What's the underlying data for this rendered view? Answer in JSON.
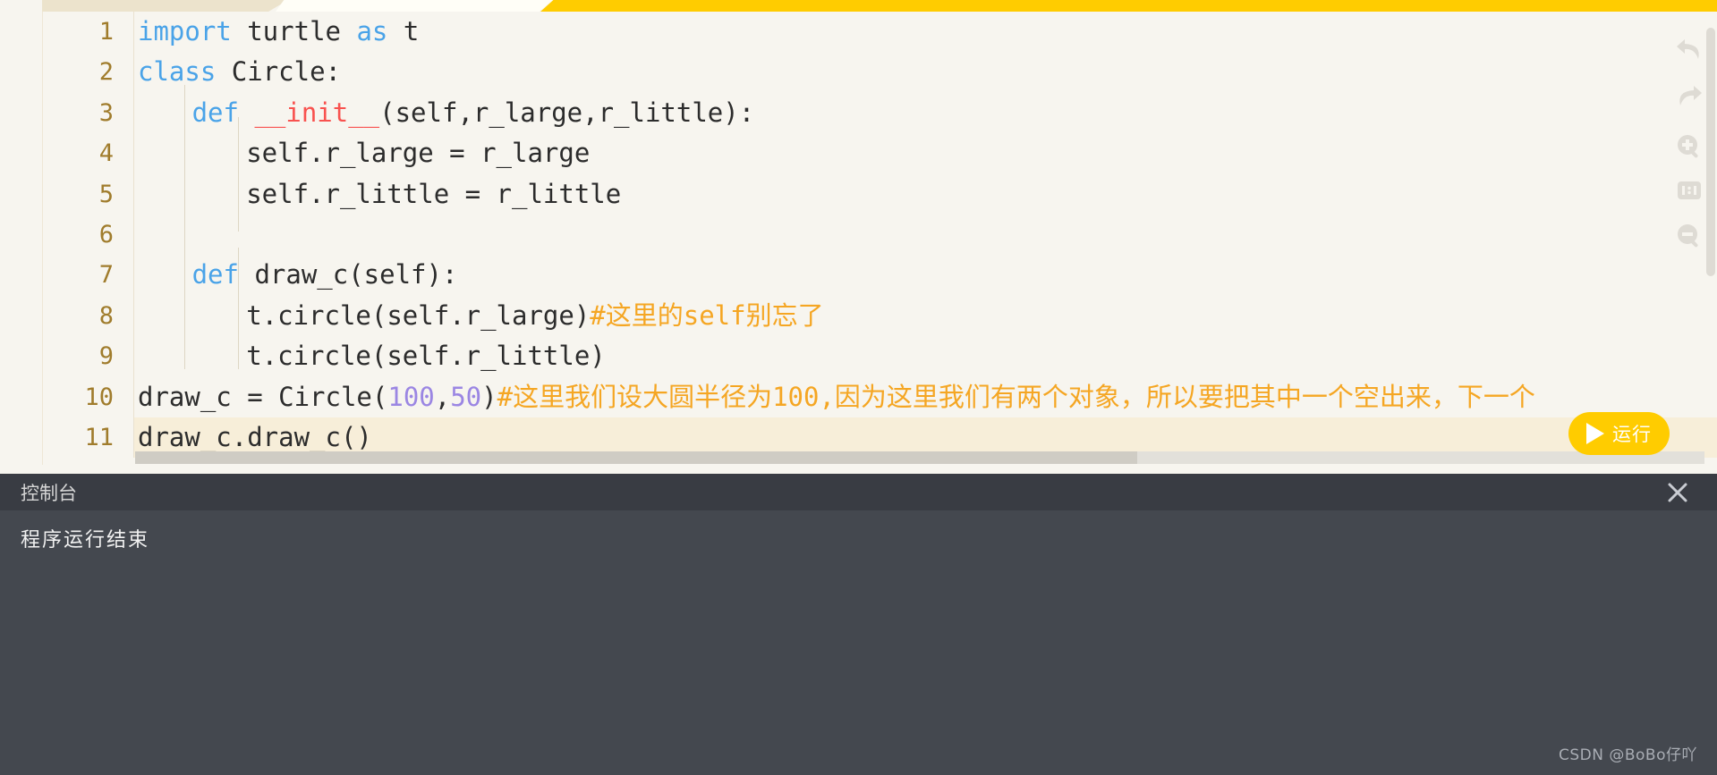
{
  "topbar": {
    "segments": [
      {
        "name": "segment-beige",
        "color": "#ece3cc"
      },
      {
        "name": "segment-white",
        "color": "#fffef7"
      },
      {
        "name": "segment-yellow",
        "color": "#ffcc00"
      }
    ]
  },
  "editor": {
    "language": "python",
    "active_line": 11,
    "colors": {
      "background": "#f7f5ef",
      "active_line": "#f7eed9",
      "line_number": "#a07c2c",
      "keyword": "#4aa3e8",
      "function": "#f8524f",
      "number": "#9b86e3",
      "comment": "#f5a623",
      "text": "#2c2c2c"
    },
    "lines": [
      {
        "num": "1",
        "indent": 0,
        "tokens": [
          {
            "t": "import",
            "c": "kw"
          },
          {
            "t": " turtle ",
            "c": "txt"
          },
          {
            "t": "as",
            "c": "kw"
          },
          {
            "t": " t",
            "c": "txt"
          }
        ]
      },
      {
        "num": "2",
        "indent": 0,
        "tokens": [
          {
            "t": "class",
            "c": "kw"
          },
          {
            "t": " Circle:",
            "c": "txt"
          }
        ]
      },
      {
        "num": "3",
        "indent": 2,
        "tokens": [
          {
            "t": "def",
            "c": "kw"
          },
          {
            "t": " ",
            "c": "txt"
          },
          {
            "t": "__init__",
            "c": "fn"
          },
          {
            "t": "(self,r_large,r_little):",
            "c": "txt"
          }
        ]
      },
      {
        "num": "4",
        "indent": 4,
        "tokens": [
          {
            "t": "self.r_large = r_large",
            "c": "txt"
          }
        ]
      },
      {
        "num": "5",
        "indent": 4,
        "tokens": [
          {
            "t": "self.r_little = r_little",
            "c": "txt"
          }
        ]
      },
      {
        "num": "6",
        "indent": 0,
        "tokens": []
      },
      {
        "num": "7",
        "indent": 2,
        "tokens": [
          {
            "t": "def",
            "c": "kw"
          },
          {
            "t": " draw_c(self):",
            "c": "txt"
          }
        ]
      },
      {
        "num": "8",
        "indent": 4,
        "tokens": [
          {
            "t": "t.circle(self.r_large)",
            "c": "txt"
          },
          {
            "t": "#这里的self别忘了",
            "c": "cmt"
          }
        ]
      },
      {
        "num": "9",
        "indent": 4,
        "tokens": [
          {
            "t": "t.circle(self.r_little)",
            "c": "txt"
          }
        ]
      },
      {
        "num": "10",
        "indent": 0,
        "tokens": [
          {
            "t": "draw_c = Circle(",
            "c": "txt"
          },
          {
            "t": "100",
            "c": "num"
          },
          {
            "t": ",",
            "c": "txt"
          },
          {
            "t": "50",
            "c": "num"
          },
          {
            "t": ")",
            "c": "txt"
          },
          {
            "t": "#这里我们设大圆半径为100,因为这里我们有两个对象，所以要把其中一个空出来，下一个",
            "c": "cmt"
          }
        ]
      },
      {
        "num": "11",
        "indent": 0,
        "tokens": [
          {
            "t": "draw_c.draw_c()",
            "c": "txt"
          }
        ]
      }
    ]
  },
  "toolbar": {
    "items": [
      {
        "name": "undo-icon",
        "tooltip": "撤销"
      },
      {
        "name": "redo-icon",
        "tooltip": "重做"
      },
      {
        "name": "zoom-in-icon",
        "tooltip": "放大"
      },
      {
        "name": "fit-width-icon",
        "tooltip": "适应宽度"
      },
      {
        "name": "zoom-out-icon",
        "tooltip": "缩小"
      }
    ]
  },
  "run_button": {
    "label": "运行",
    "color": "#ffcc00",
    "icon": "play-icon"
  },
  "console": {
    "title": "控制台",
    "close_icon": "close-icon",
    "output": "程序运行结束",
    "header_color": "#393c43",
    "body_color": "#44484f"
  },
  "watermark": {
    "text": "CSDN @BoBo仔吖"
  }
}
